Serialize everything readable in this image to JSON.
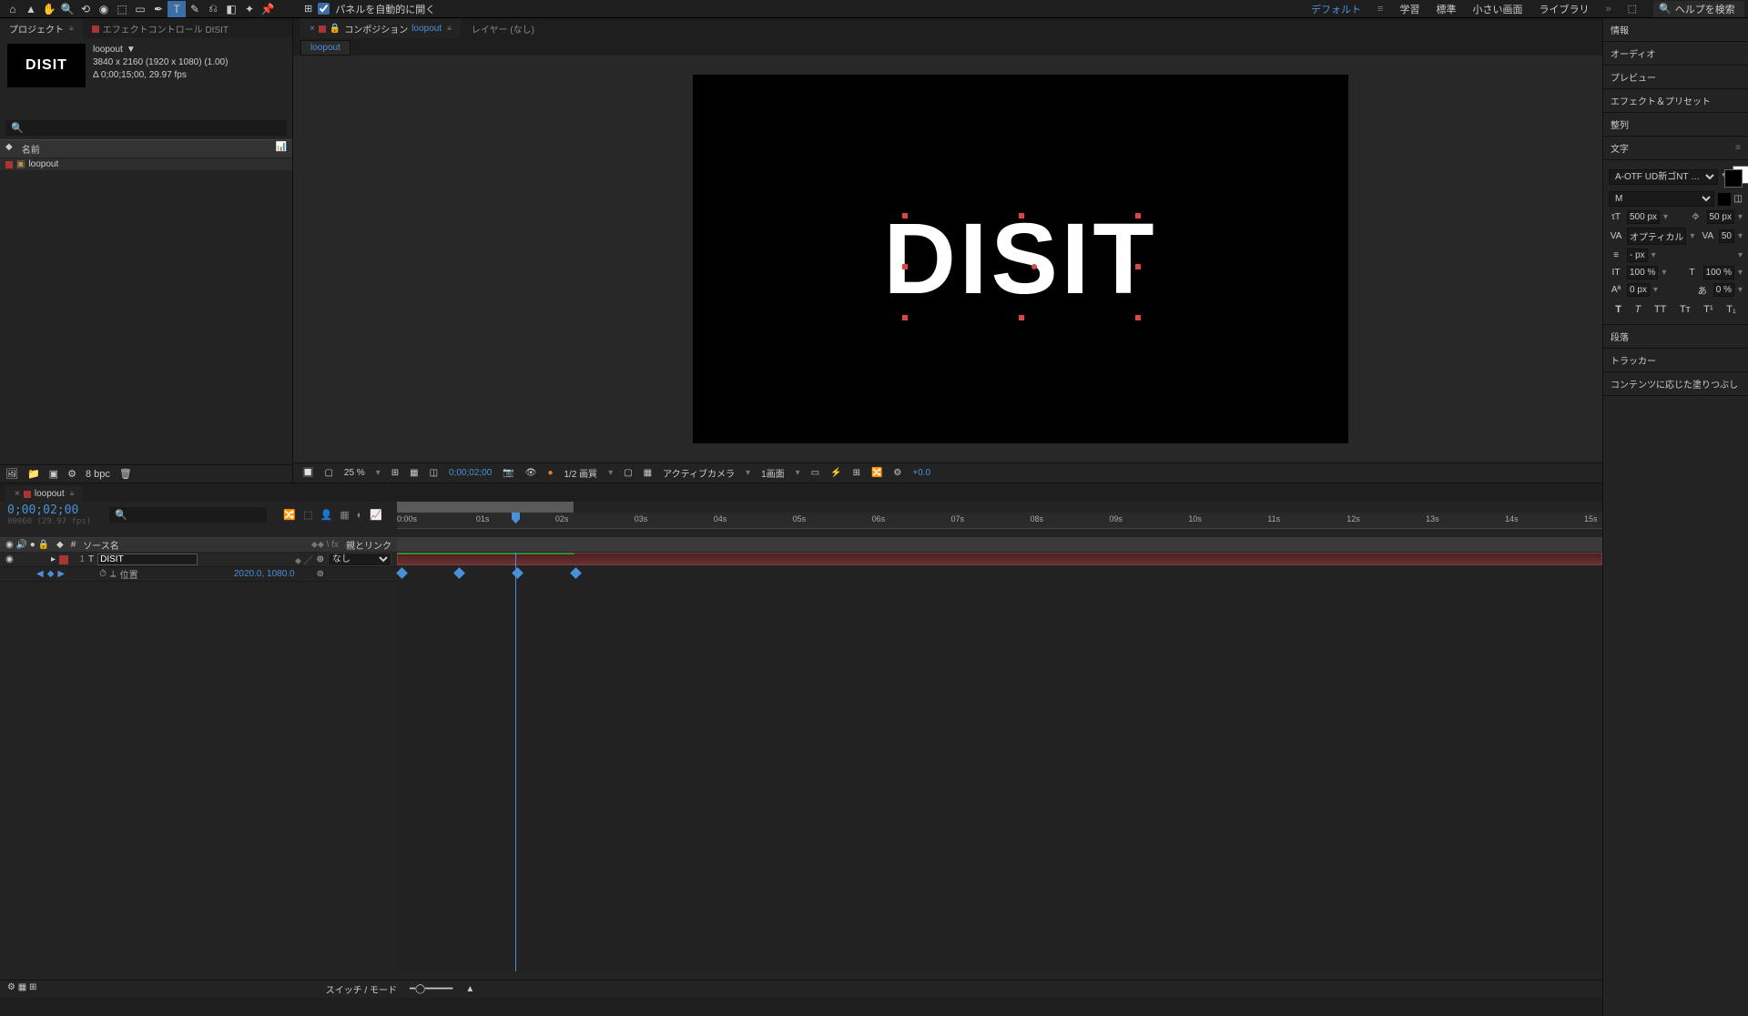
{
  "top": {
    "autoOpen": "パネルを自動的に開く",
    "workspaces": [
      "デフォルト",
      "学習",
      "標準",
      "小さい画面",
      "ライブラリ"
    ],
    "helpSearch": "ヘルプを検索"
  },
  "project": {
    "tabProject": "プロジェクト",
    "tabEffect": "エフェクトコントロール DISIT",
    "compName": "loopout",
    "res": "3840 x 2160  (1920 x 1080) (1.00)",
    "dur": "Δ 0;00;15;00, 29.97 fps",
    "colName": "名前",
    "item1": "loopout",
    "bpc": "8 bpc"
  },
  "comp": {
    "tabLabel": "コンポジション",
    "tabComp": "loopout",
    "tabLayer": "レイヤー (なし)",
    "flowchart": "loopout",
    "text": "DISIT",
    "zoom": "25 %",
    "time": "0;00;02;00",
    "quality": "1/2 画質",
    "camera": "アクティブカメラ",
    "view": "1画面",
    "exp": "+0.0"
  },
  "right": {
    "panels": [
      "情報",
      "オーディオ",
      "プレビュー",
      "エフェクト＆プリセット",
      "整列"
    ],
    "charTitle": "文字",
    "font": "A-OTF UD新ゴNT …",
    "weight": "M",
    "size": "500 px",
    "leading": "50 px",
    "kerning": "オプティカル",
    "tracking": "50",
    "stroke": "- px",
    "vscale": "100 %",
    "hscale": "100 %",
    "baseline": "0 px",
    "tsume": "0 %",
    "panels2": [
      "段落",
      "トラッカー",
      "コンテンツに応じた塗りつぶし"
    ]
  },
  "timeline": {
    "tab": "loopout",
    "tc": "0;00;02;00",
    "tcSub": "00060 (29.97 fps)",
    "colSource": "ソース名",
    "colParent": "親とリンク",
    "colMode1": "⬥⬥ \\ fx",
    "layerNum": "1",
    "layerName": "DISIT",
    "parentNone": "なし",
    "propName": "位置",
    "propVal": "2020.0, 1080.0",
    "ticks": [
      "0:00s",
      "01s",
      "02s",
      "03s",
      "04s",
      "05s",
      "06s",
      "07s",
      "08s",
      "09s",
      "10s",
      "11s",
      "12s",
      "13s",
      "14s",
      "15s"
    ],
    "footSwitch": "スイッチ / モード"
  }
}
